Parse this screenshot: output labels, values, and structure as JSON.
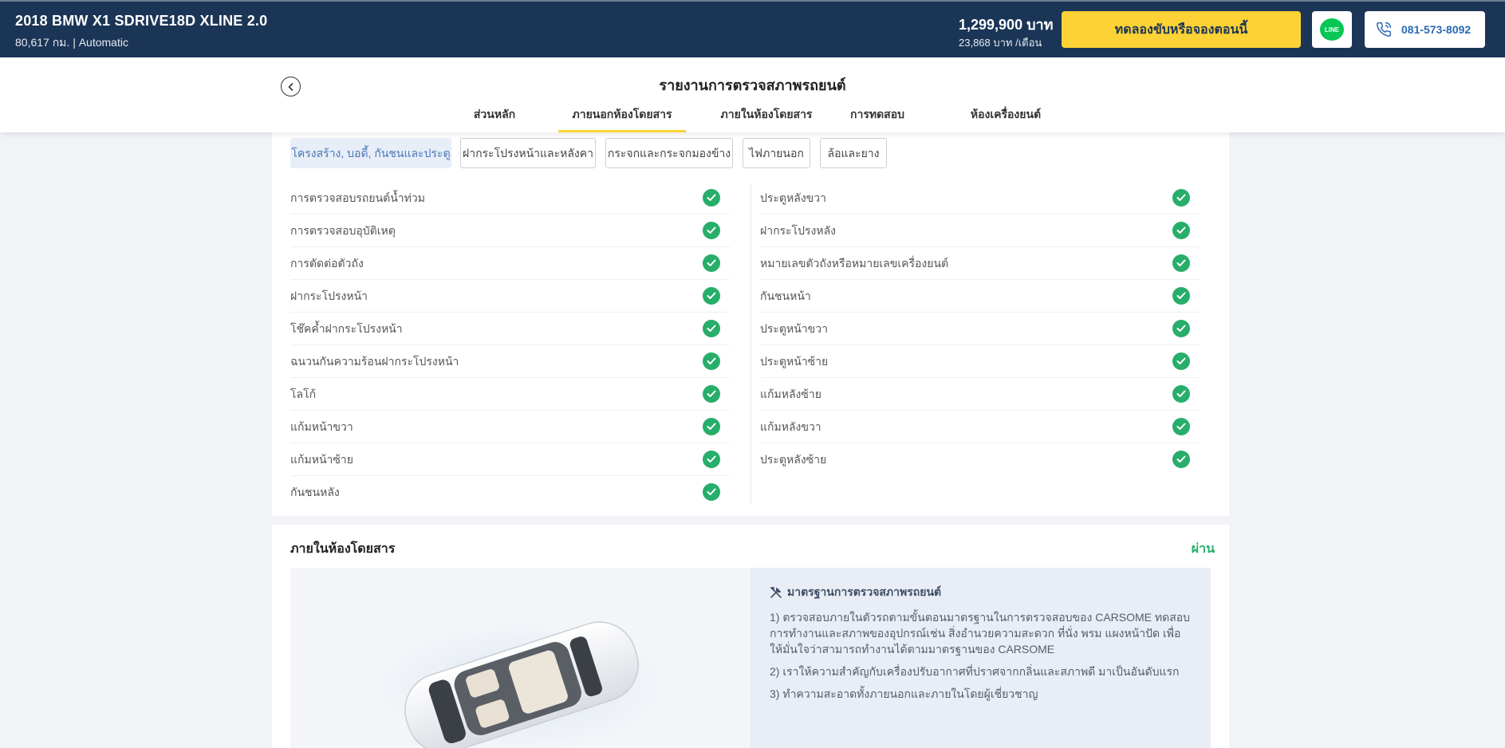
{
  "header": {
    "car_title": "2018 BMW X1 SDRIVE18D XLINE 2.0",
    "car_sub": "80,617 กม. | Automatic",
    "price": "1,299,900 บาท",
    "monthly": "23,868 บาท /เดือน",
    "cta_label": "ทดลองขับหรือจองตอนนี้",
    "line_label": "LINE",
    "phone": "081-573-8092"
  },
  "report": {
    "title": "รายงานการตรวจสภาพรถยนต์",
    "tabs": [
      {
        "label": "ส่วนหลัก"
      },
      {
        "label": "ภายนอกห้องโดยสาร"
      },
      {
        "label": "ภายในห้องโดยสาร"
      },
      {
        "label": "การทดสอบ"
      },
      {
        "label": "ห้องเครื่องยนต์"
      }
    ],
    "active_tab": 1
  },
  "exterior": {
    "chips": [
      {
        "label": "โครงสร้าง, บอดี้, กันชนและประตู"
      },
      {
        "label": "ฝากระโปรงหน้าและหลังคา"
      },
      {
        "label": "กระจกและกระจกมองข้าง"
      },
      {
        "label": "ไฟภายนอก"
      },
      {
        "label": "ล้อและยาง"
      }
    ],
    "left_items": [
      {
        "label": "การตรวจสอบรถยนต์น้ำท่วม"
      },
      {
        "label": "การตรวจสอบอุบัติเหตุ"
      },
      {
        "label": "การตัดต่อตัวถัง"
      },
      {
        "label": "ฝากระโปรงหน้า"
      },
      {
        "label": "โช๊คค้ำฝากระโปรงหน้า"
      },
      {
        "label": "ฉนวนกันความร้อนฝากระโปรงหน้า"
      },
      {
        "label": "โลโก้"
      },
      {
        "label": "แก้มหน้าขวา"
      },
      {
        "label": "แก้มหน้าซ้าย"
      },
      {
        "label": "กันชนหลัง"
      }
    ],
    "right_items": [
      {
        "label": "ประตูหลังขวา"
      },
      {
        "label": "ฝากระโปรงหลัง"
      },
      {
        "label": "หมายเลขตัวถังหรือหมายเลขเครื่องยนต์"
      },
      {
        "label": "กันชนหน้า"
      },
      {
        "label": "ประตูหน้าขวา"
      },
      {
        "label": "ประตูหน้าซ้าย"
      },
      {
        "label": "แก้มหลังซ้าย"
      },
      {
        "label": "แก้มหลังขวา"
      },
      {
        "label": "ประตูหลังซ้าย"
      }
    ],
    "check_color": "#27ae6a"
  },
  "interior": {
    "title": "ภายในห้องโดยสาร",
    "status": "ผ่าน",
    "info_title": "มาตรฐานการตรวจสภาพรถยนต์",
    "info_points": [
      "1) ตรวจสอบภายในตัวรถตามขั้นตอนมาตรฐานในการตรวจสอบของ CARSOME ทดสอบการทำงานและสภาพของอุปกรณ์เช่น สิ่งอำนวยความสะดวก ที่นั่ง พรม แผงหน้าปัด เพื่อให้มั่นใจว่าสามารถทำงานได้ตามมาตรฐานของ CARSOME",
      "2) เราให้ความสำคัญกับเครื่องปรับอากาศที่ปราศจากกลิ่นและสภาพดี มาเป็นอันดับแรก",
      "3) ทำความสะอาดทั้งภายนอกและภายในโดยผู้เชี่ยวชาญ"
    ]
  },
  "colors": {
    "header_bg": "#1b3556",
    "cta_bg": "#fdd235",
    "pass_green": "#27ae6a",
    "link_blue": "#2a69b3"
  }
}
